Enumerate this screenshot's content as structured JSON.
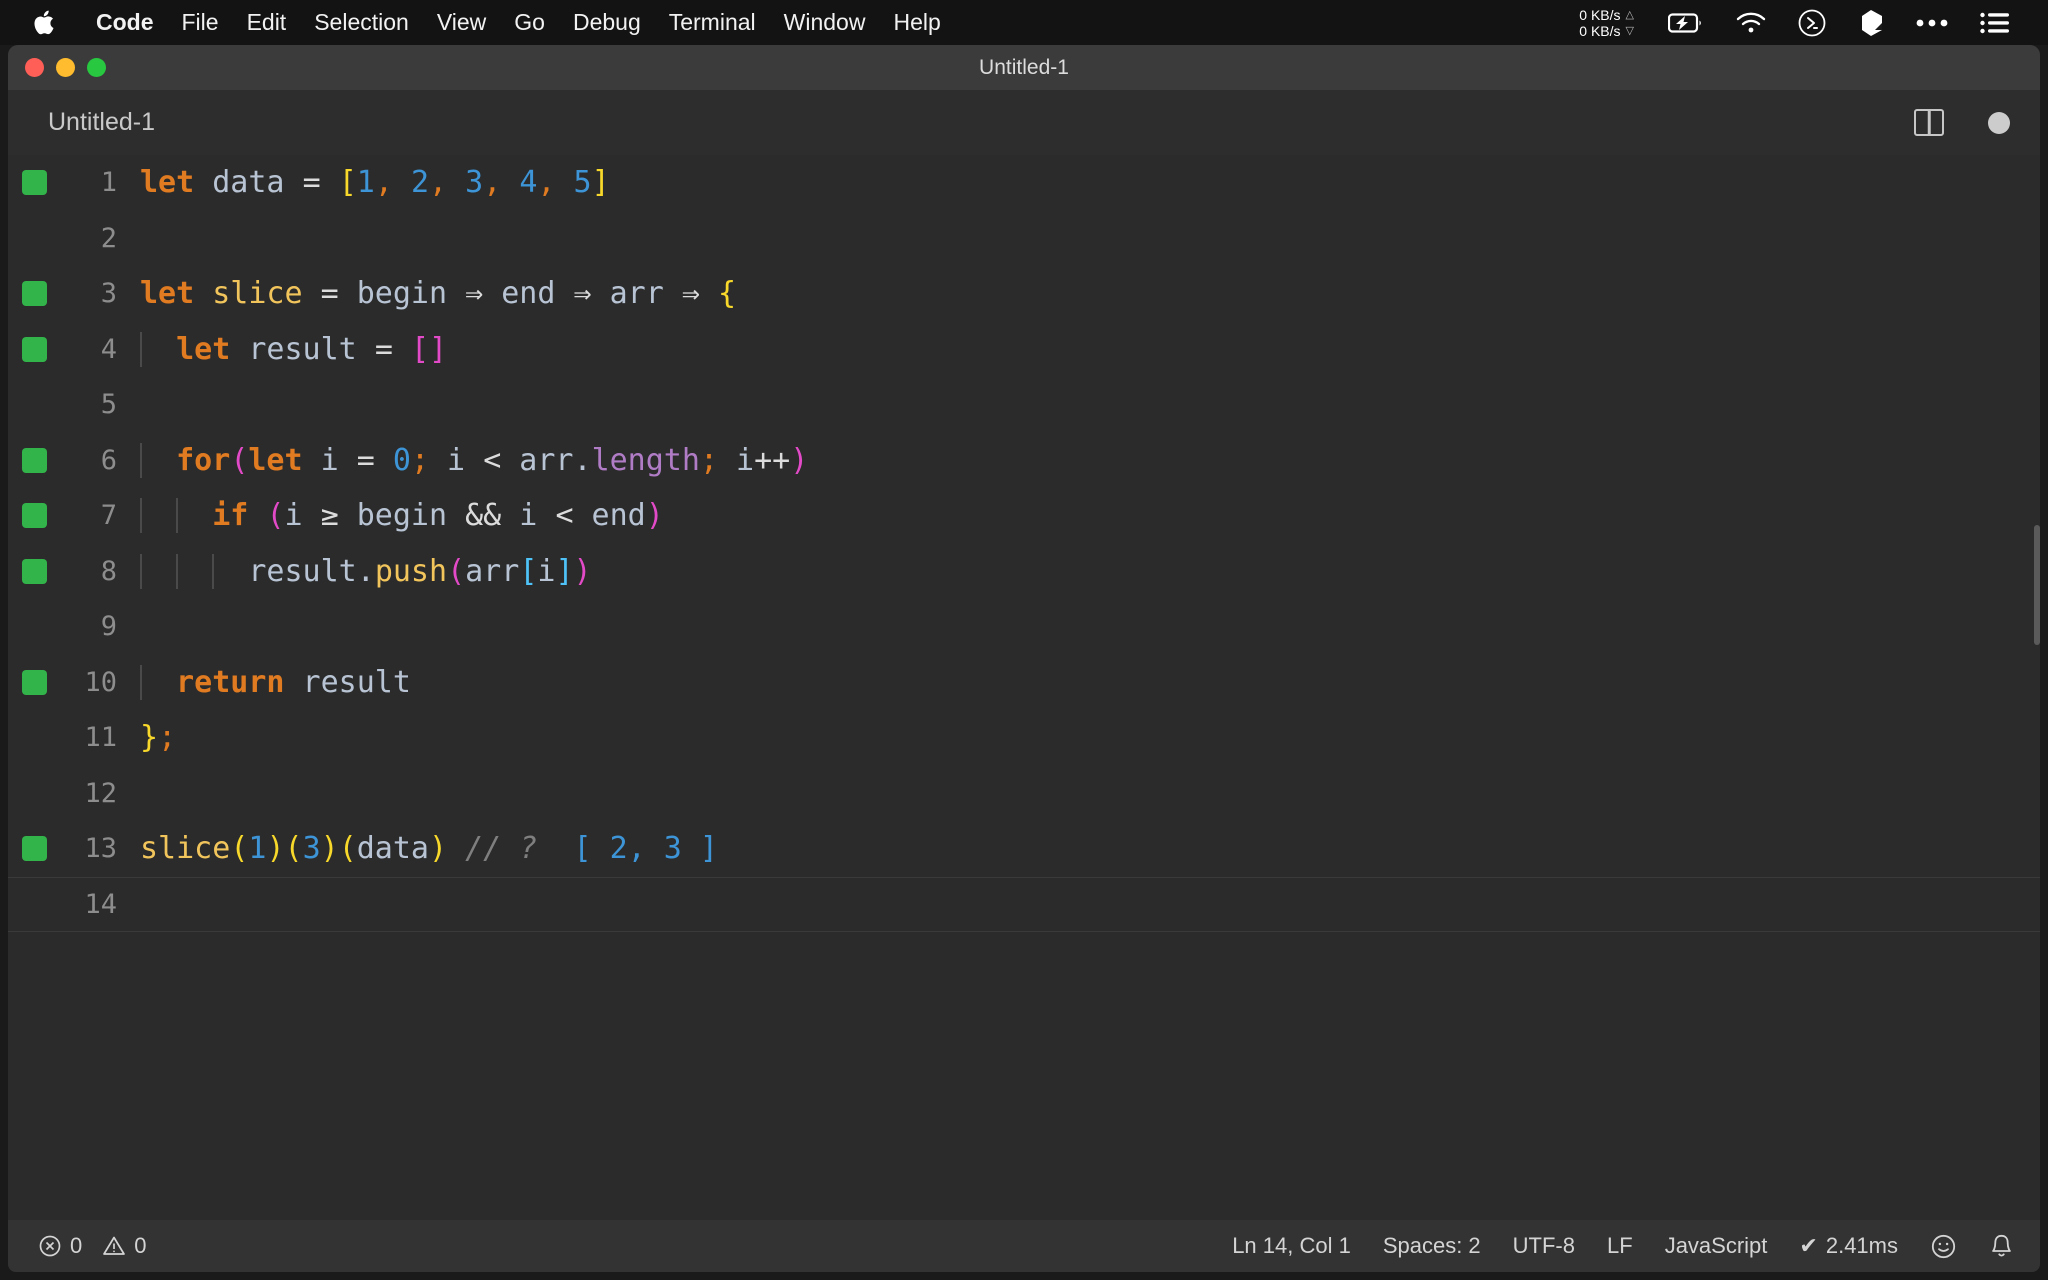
{
  "menubar": {
    "apple_icon": "apple-logo",
    "items": [
      {
        "label": "Code",
        "bold": true
      },
      {
        "label": "File",
        "bold": false
      },
      {
        "label": "Edit",
        "bold": false
      },
      {
        "label": "Selection",
        "bold": false
      },
      {
        "label": "View",
        "bold": false
      },
      {
        "label": "Go",
        "bold": false
      },
      {
        "label": "Debug",
        "bold": false
      },
      {
        "label": "Terminal",
        "bold": false
      },
      {
        "label": "Window",
        "bold": false
      },
      {
        "label": "Help",
        "bold": false
      }
    ],
    "tray": {
      "network_up": "0 KB/s",
      "network_down": "0 KB/s",
      "icons": [
        "battery-charging-icon",
        "wifi-icon",
        "terminal-icon",
        "dropbox-icon",
        "ellipsis-icon",
        "list-menu-icon"
      ]
    }
  },
  "window": {
    "title": "Untitled-1",
    "traffic_lights": [
      "close-button",
      "minimize-button",
      "maximize-button"
    ]
  },
  "editor": {
    "filename": "Untitled-1",
    "split_icon": "split-editor-icon",
    "dirty_indicator": "unsaved-changes-dot",
    "language": "JavaScript",
    "lines": [
      {
        "number": "1",
        "breakpoint": true,
        "indent_guides": 0,
        "tokens": [
          {
            "text": "let",
            "cls": "t-kw"
          },
          {
            "text": " data ",
            "cls": "t-var"
          },
          {
            "text": "=",
            "cls": "t-op"
          },
          {
            "text": " ",
            "cls": "t-var"
          },
          {
            "text": "[",
            "cls": "t-br1"
          },
          {
            "text": "1",
            "cls": "t-num"
          },
          {
            "text": ",",
            "cls": "t-punct"
          },
          {
            "text": " ",
            "cls": "t-var"
          },
          {
            "text": "2",
            "cls": "t-num"
          },
          {
            "text": ",",
            "cls": "t-punct"
          },
          {
            "text": " ",
            "cls": "t-var"
          },
          {
            "text": "3",
            "cls": "t-num"
          },
          {
            "text": ",",
            "cls": "t-punct"
          },
          {
            "text": " ",
            "cls": "t-var"
          },
          {
            "text": "4",
            "cls": "t-num"
          },
          {
            "text": ",",
            "cls": "t-punct"
          },
          {
            "text": " ",
            "cls": "t-var"
          },
          {
            "text": "5",
            "cls": "t-num"
          },
          {
            "text": "]",
            "cls": "t-br1"
          }
        ]
      },
      {
        "number": "2",
        "breakpoint": false,
        "indent_guides": 0,
        "tokens": []
      },
      {
        "number": "3",
        "breakpoint": true,
        "indent_guides": 0,
        "tokens": [
          {
            "text": "let",
            "cls": "t-kw"
          },
          {
            "text": " ",
            "cls": "t-var"
          },
          {
            "text": "slice",
            "cls": "t-fn"
          },
          {
            "text": " ",
            "cls": "t-var"
          },
          {
            "text": "=",
            "cls": "t-op"
          },
          {
            "text": " begin ",
            "cls": "t-var"
          },
          {
            "text": "⇒",
            "cls": "t-op"
          },
          {
            "text": " end ",
            "cls": "t-var"
          },
          {
            "text": "⇒",
            "cls": "t-op"
          },
          {
            "text": " arr ",
            "cls": "t-var"
          },
          {
            "text": "⇒",
            "cls": "t-op"
          },
          {
            "text": " ",
            "cls": "t-var"
          },
          {
            "text": "{",
            "cls": "t-br1"
          }
        ]
      },
      {
        "number": "4",
        "breakpoint": true,
        "indent_guides": 1,
        "tokens": [
          {
            "text": "  ",
            "cls": "t-var"
          },
          {
            "text": "let",
            "cls": "t-kw"
          },
          {
            "text": " result ",
            "cls": "t-var"
          },
          {
            "text": "=",
            "cls": "t-op"
          },
          {
            "text": " ",
            "cls": "t-var"
          },
          {
            "text": "[]",
            "cls": "t-br2"
          }
        ]
      },
      {
        "number": "5",
        "breakpoint": false,
        "indent_guides": 1,
        "tokens": []
      },
      {
        "number": "6",
        "breakpoint": true,
        "indent_guides": 1,
        "tokens": [
          {
            "text": "  ",
            "cls": "t-var"
          },
          {
            "text": "for",
            "cls": "t-kw"
          },
          {
            "text": "(",
            "cls": "t-br2"
          },
          {
            "text": "let",
            "cls": "t-kw"
          },
          {
            "text": " i ",
            "cls": "t-var"
          },
          {
            "text": "=",
            "cls": "t-op"
          },
          {
            "text": " ",
            "cls": "t-var"
          },
          {
            "text": "0",
            "cls": "t-num"
          },
          {
            "text": ";",
            "cls": "t-punct"
          },
          {
            "text": " i ",
            "cls": "t-var"
          },
          {
            "text": "<",
            "cls": "t-op"
          },
          {
            "text": " arr",
            "cls": "t-var"
          },
          {
            "text": ".",
            "cls": "t-var"
          },
          {
            "text": "length",
            "cls": "t-prop"
          },
          {
            "text": ";",
            "cls": "t-punct"
          },
          {
            "text": " i",
            "cls": "t-var"
          },
          {
            "text": "++",
            "cls": "t-op"
          },
          {
            "text": ")",
            "cls": "t-br2"
          }
        ]
      },
      {
        "number": "7",
        "breakpoint": true,
        "indent_guides": 2,
        "tokens": [
          {
            "text": "    ",
            "cls": "t-var"
          },
          {
            "text": "if",
            "cls": "t-kw"
          },
          {
            "text": " ",
            "cls": "t-var"
          },
          {
            "text": "(",
            "cls": "t-br2"
          },
          {
            "text": "i ",
            "cls": "t-var"
          },
          {
            "text": "≥",
            "cls": "t-op"
          },
          {
            "text": " begin ",
            "cls": "t-var"
          },
          {
            "text": "&&",
            "cls": "t-op"
          },
          {
            "text": " i ",
            "cls": "t-var"
          },
          {
            "text": "<",
            "cls": "t-op"
          },
          {
            "text": " end",
            "cls": "t-var"
          },
          {
            "text": ")",
            "cls": "t-br2"
          }
        ]
      },
      {
        "number": "8",
        "breakpoint": true,
        "indent_guides": 3,
        "tokens": [
          {
            "text": "      ",
            "cls": "t-var"
          },
          {
            "text": "result",
            "cls": "t-var"
          },
          {
            "text": ".",
            "cls": "t-var"
          },
          {
            "text": "push",
            "cls": "t-fn"
          },
          {
            "text": "(",
            "cls": "t-br2"
          },
          {
            "text": "arr",
            "cls": "t-var"
          },
          {
            "text": "[",
            "cls": "t-br3"
          },
          {
            "text": "i",
            "cls": "t-var"
          },
          {
            "text": "]",
            "cls": "t-br3"
          },
          {
            "text": ")",
            "cls": "t-br2"
          }
        ]
      },
      {
        "number": "9",
        "breakpoint": false,
        "indent_guides": 2,
        "tokens": []
      },
      {
        "number": "10",
        "breakpoint": true,
        "indent_guides": 1,
        "tokens": [
          {
            "text": "  ",
            "cls": "t-var"
          },
          {
            "text": "return",
            "cls": "t-kw"
          },
          {
            "text": " result",
            "cls": "t-var"
          }
        ]
      },
      {
        "number": "11",
        "breakpoint": false,
        "indent_guides": 0,
        "tokens": [
          {
            "text": "}",
            "cls": "t-br1"
          },
          {
            "text": ";",
            "cls": "t-punct"
          }
        ]
      },
      {
        "number": "12",
        "breakpoint": false,
        "indent_guides": 0,
        "tokens": []
      },
      {
        "number": "13",
        "breakpoint": true,
        "indent_guides": 0,
        "tokens": [
          {
            "text": "slice",
            "cls": "t-fn"
          },
          {
            "text": "(",
            "cls": "t-br1"
          },
          {
            "text": "1",
            "cls": "t-num"
          },
          {
            "text": ")",
            "cls": "t-br1"
          },
          {
            "text": "(",
            "cls": "t-br1"
          },
          {
            "text": "3",
            "cls": "t-num"
          },
          {
            "text": ")",
            "cls": "t-br1"
          },
          {
            "text": "(",
            "cls": "t-br1"
          },
          {
            "text": "data",
            "cls": "t-var"
          },
          {
            "text": ")",
            "cls": "t-br1"
          },
          {
            "text": " ",
            "cls": "t-var"
          },
          {
            "text": "// ?",
            "cls": "t-comment"
          },
          {
            "text": "  ",
            "cls": "t-var"
          },
          {
            "text": "[ 2, 3 ]",
            "cls": "t-cnum"
          }
        ]
      },
      {
        "number": "14",
        "breakpoint": false,
        "indent_guides": 0,
        "cursor": true,
        "tokens": []
      }
    ]
  },
  "statusbar": {
    "errors_icon": "error-circle-icon",
    "errors_count": "0",
    "warnings_icon": "warning-triangle-icon",
    "warnings_count": "0",
    "cursor_position": "Ln 14, Col 1",
    "indentation": "Spaces: 2",
    "encoding": "UTF-8",
    "line_ending": "LF",
    "language_mode": "JavaScript",
    "timing": "2.41ms",
    "timing_check": "✔",
    "feedback_icon": "smiley-icon",
    "notifications_icon": "bell-icon"
  },
  "colors": {
    "menubar_bg": "#131313",
    "titlebar_bg": "#3b3b3b",
    "editor_bg": "#2b2b2b",
    "statusbar_bg": "#333333",
    "breakpoint_green": "#33b44a",
    "keyword_orange": "#e07b21",
    "function_yellow": "#f2c55c",
    "number_blue": "#3d94d6",
    "bracket_yellow": "#f7d82b",
    "bracket_magenta": "#e34ac8",
    "bracket_cyan": "#4fc3f7",
    "property_purple": "#b07cc6",
    "comment_gray": "#7f7f7f"
  }
}
